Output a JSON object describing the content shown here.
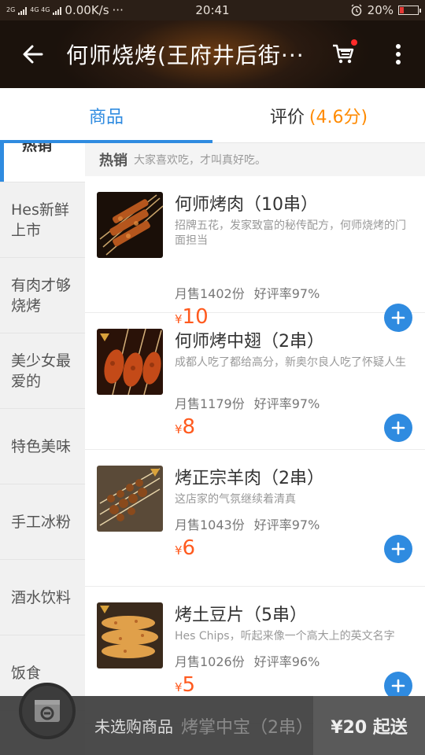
{
  "status_bar": {
    "network": "2G",
    "network2": "4G 4G",
    "speed": "0.00K/s",
    "dots": "···",
    "time": "20:41",
    "battery": "20%",
    "battery_level": 0.2
  },
  "header": {
    "title": "何师烧烤(王府井后街···",
    "accent": "#2f8be0"
  },
  "tabs": [
    {
      "label": "商品"
    },
    {
      "label": "评价",
      "extra": "(4.6分)"
    }
  ],
  "sidebar": {
    "items": [
      {
        "label": "热销"
      },
      {
        "label": "Hes新鲜上市"
      },
      {
        "label": "有肉才够烧烤"
      },
      {
        "label": "美少女最爱的"
      },
      {
        "label": "特色美味"
      },
      {
        "label": "手工冰粉"
      },
      {
        "label": "酒水饮料"
      },
      {
        "label": "饭食"
      }
    ]
  },
  "section": {
    "title": "热销",
    "desc": "大家喜欢吃，才叫真好吃。"
  },
  "products": [
    {
      "name": "何师烤肉（10串）",
      "desc": "招牌五花，发家致富的秘传配方，何师烧烤的门面担当",
      "sales": "月售1402份",
      "rating": "好评率97%",
      "currency": "¥",
      "price": "10"
    },
    {
      "name": "何师烤中翅（2串）",
      "desc": "成都人吃了都给高分，新奥尔良人吃了怀疑人生",
      "sales": "月售1179份",
      "rating": "好评率97%",
      "currency": "¥",
      "price": "8"
    },
    {
      "name": "烤正宗羊肉（2串）",
      "desc": "这店家的气氛继续着清真",
      "sales": "月售1043份",
      "rating": "好评率97%",
      "currency": "¥",
      "price": "6"
    },
    {
      "name": "烤土豆片（5串）",
      "desc": "Hes Chips，听起来像一个高大上的英文名字",
      "sales": "月售1026份",
      "rating": "好评率96%",
      "currency": "¥",
      "price": "5"
    }
  ],
  "bottom_bar": {
    "empty_text": "未选购商品",
    "peek_text": "烤掌中宝（2串）",
    "min_order": "¥20 起送"
  }
}
